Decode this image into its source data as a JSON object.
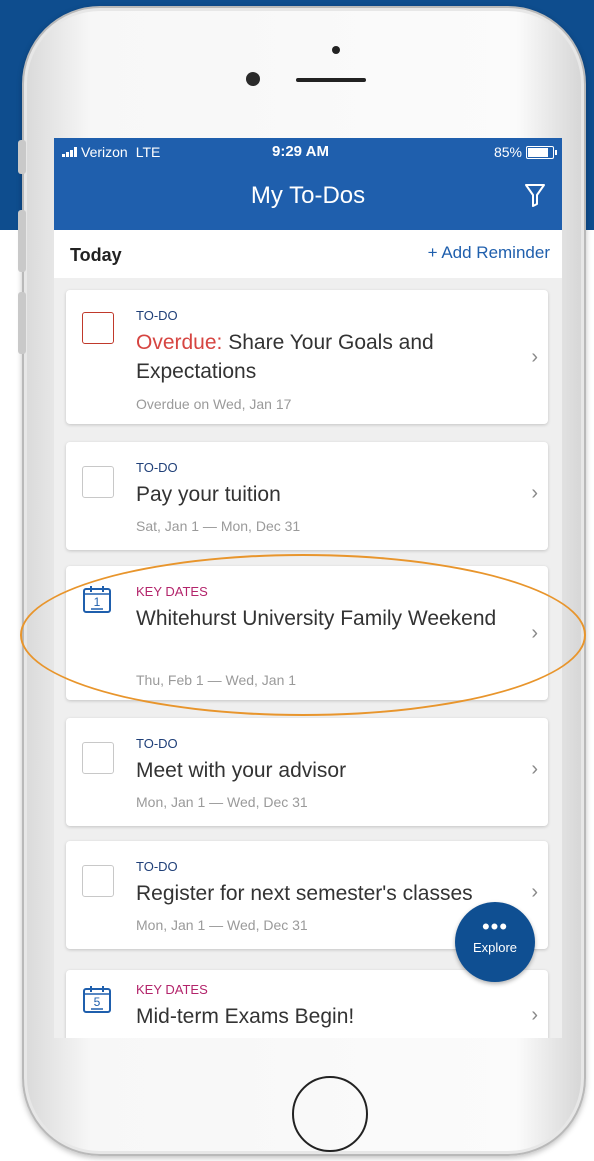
{
  "status_bar": {
    "carrier": "Verizon",
    "network": "LTE",
    "time": "9:29 AM",
    "battery": "85%"
  },
  "header": {
    "title": "My To-Dos",
    "filter_icon": "filter-icon"
  },
  "section": {
    "label": "Today",
    "add_reminder": "+ Add Reminder"
  },
  "cards": [
    {
      "type": "TO-DO",
      "prefix": "Overdue:",
      "title": " Share Your Goals and Expectations",
      "date": "Overdue on Wed, Jan 17",
      "icon": "checkbox-overdue"
    },
    {
      "type": "TO-DO",
      "title": "Pay your tuition",
      "date": "Sat, Jan 1 — Mon, Dec 31",
      "icon": "checkbox"
    },
    {
      "type": "KEY DATES",
      "title": "Whitehurst University Family Weekend",
      "date": "Thu, Feb 1 — Wed, Jan 1",
      "icon": "calendar-icon",
      "day": "1"
    },
    {
      "type": "TO-DO",
      "title": "Meet with your advisor",
      "date": "Mon, Jan 1 — Wed, Dec 31",
      "icon": "checkbox"
    },
    {
      "type": "TO-DO",
      "title": "Register for next semester's classes",
      "date": "Mon, Jan 1 — Wed, Dec 31",
      "icon": "checkbox"
    },
    {
      "type": "KEY DATES",
      "title": "Mid-term Exams Begin!",
      "icon": "calendar-icon",
      "day": "5"
    }
  ],
  "explore": {
    "dots": "•••",
    "label": "Explore"
  },
  "chevron": "›",
  "colors": {
    "header_blue": "#1f5fad",
    "explore_blue": "#0f4f92",
    "key_dates_magenta": "#b3246b",
    "overdue_red": "#d64541",
    "highlight_orange": "#e8952c"
  }
}
